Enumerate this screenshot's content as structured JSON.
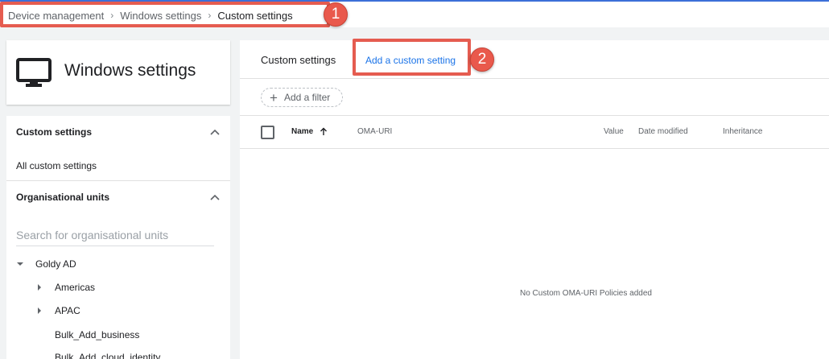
{
  "breadcrumb": {
    "items": [
      "Device management",
      "Windows settings"
    ],
    "current": "Custom settings",
    "separator": "›"
  },
  "callouts": [
    "1",
    "2"
  ],
  "left": {
    "header_title": "Windows settings",
    "header_icon": "monitor-icon",
    "sections": {
      "custom_settings": "Custom settings",
      "all_custom_settings": "All custom settings",
      "org_units": "Organisational units"
    },
    "search_placeholder": "Search for organisational units",
    "tree": {
      "root": "Goldy AD",
      "children": [
        "Americas",
        "APAC",
        "Bulk_Add_business",
        "Bulk_Add_cloud_identity"
      ]
    }
  },
  "right": {
    "tab_title": "Custom settings",
    "add_link": "Add a custom setting",
    "filter_label": "Add a filter",
    "columns": {
      "name": "Name",
      "oma_uri": "OMA-URI",
      "value": "Value",
      "date_modified": "Date modified",
      "inheritance": "Inheritance"
    },
    "empty_message": "No Custom OMA-URI Policies added"
  },
  "colors": {
    "accent": "#1a73e8",
    "callout": "#e9594c",
    "background": "#f1f3f4"
  }
}
